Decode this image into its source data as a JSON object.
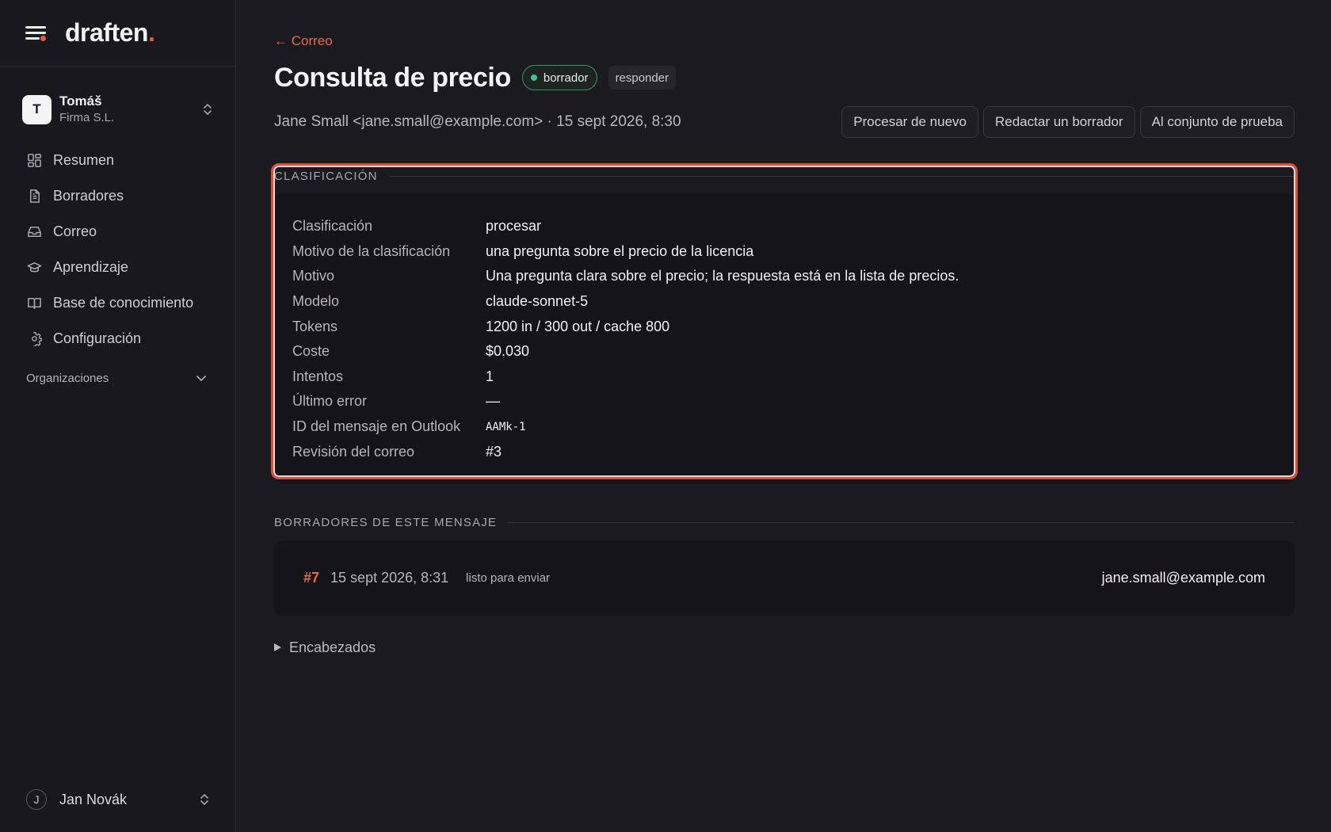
{
  "brand": {
    "logo_text": "draften",
    "logo_dot": "."
  },
  "workspace": {
    "initial": "T",
    "name": "Tomáš",
    "org": "Firma S.L."
  },
  "nav": {
    "items": [
      {
        "label": "Resumen",
        "icon": "grid-icon"
      },
      {
        "label": "Borradores",
        "icon": "document-icon"
      },
      {
        "label": "Correo",
        "icon": "inbox-icon"
      },
      {
        "label": "Aprendizaje",
        "icon": "graduation-cap-icon"
      },
      {
        "label": "Base de conocimiento",
        "icon": "book-icon"
      },
      {
        "label": "Configuración",
        "icon": "gear-icon"
      }
    ],
    "orgs_label": "Organizaciones"
  },
  "user": {
    "initial": "J",
    "name": "Jan Novák"
  },
  "header": {
    "back_label": "← Correo",
    "title": "Consulta de precio",
    "status_badge": "borrador",
    "tag": "responder",
    "meta": "Jane Small <jane.small@example.com> · 15 sept 2026, 8:30",
    "actions": [
      "Procesar de nuevo",
      "Redactar un borrador",
      "Al conjunto de prueba"
    ]
  },
  "classification": {
    "section_title": "CLASIFICACIÓN",
    "rows": [
      {
        "k": "Clasificación",
        "v": "procesar"
      },
      {
        "k": "Motivo de la clasificación",
        "v": "una pregunta sobre el precio de la licencia"
      },
      {
        "k": "Motivo",
        "v": "Una pregunta clara sobre el precio; la respuesta está en la lista de precios."
      },
      {
        "k": "Modelo",
        "v": "claude-sonnet-5"
      },
      {
        "k": "Tokens",
        "v": "1200 in / 300 out / cache 800"
      },
      {
        "k": "Coste",
        "v": "$0.030"
      },
      {
        "k": "Intentos",
        "v": "1"
      },
      {
        "k": "Último error",
        "v": "—"
      },
      {
        "k": "ID del mensaje en Outlook",
        "v": "AAMk-1"
      },
      {
        "k": "Revisión del correo",
        "v": "#3"
      }
    ]
  },
  "drafts": {
    "section_title": "BORRADORES DE ESTE MENSAJE",
    "item": {
      "num": "#7",
      "date": "15 sept 2026, 8:31",
      "status": "listo para enviar",
      "to": "jane.small@example.com"
    }
  },
  "headers_toggle": "Encabezados",
  "colors": {
    "accent": "#e5694f",
    "badge_green": "#3ec28a",
    "highlight": "#e24b36"
  }
}
